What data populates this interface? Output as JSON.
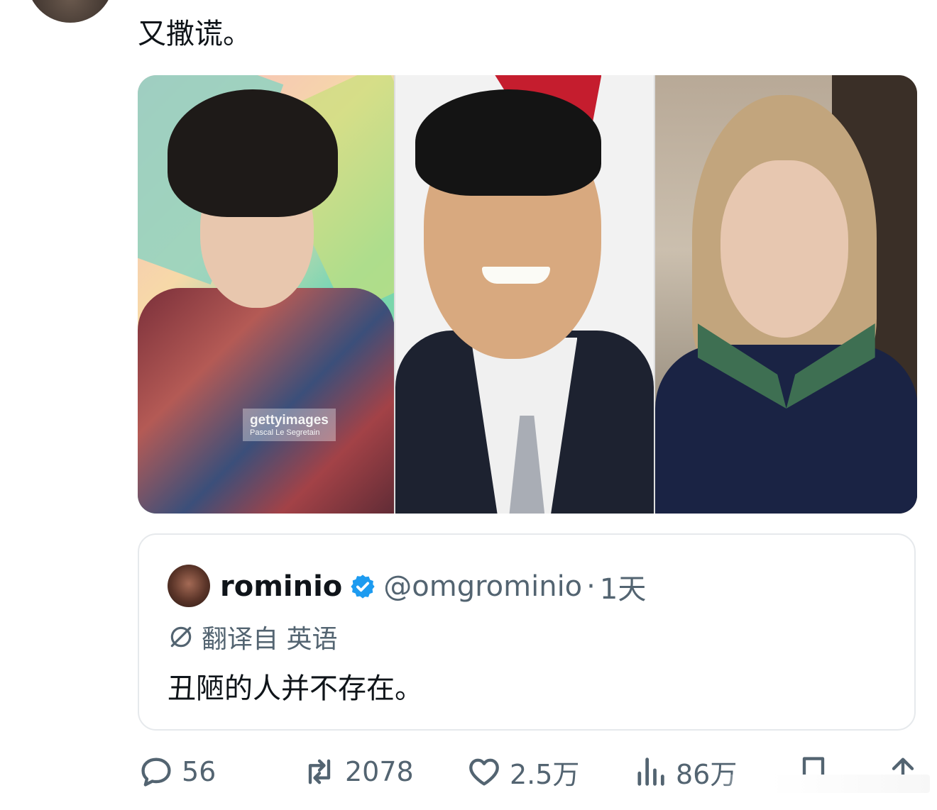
{
  "tweet": {
    "text": "又撒谎。"
  },
  "media": {
    "watermark_brand": "gettyimages",
    "watermark_credit": "Pascal Le Segretain"
  },
  "quote": {
    "display_name": "rominio",
    "handle": "@omgrominio",
    "separator": "·",
    "time": "1天",
    "translate_label": "翻译自 英语",
    "body": "丑陋的人并不存在。",
    "verified_icon": "verified-badge-icon",
    "verified_color": "#1d9bf0"
  },
  "actions": {
    "reply_count": "56",
    "retweet_count": "2078",
    "like_count": "2.5万",
    "views_count": "86万",
    "reply_icon": "reply-icon",
    "retweet_icon": "retweet-icon",
    "like_icon": "heart-icon",
    "views_icon": "views-icon",
    "bookmark_icon": "bookmark-icon",
    "share_icon": "share-icon",
    "icon_color": "#536471"
  }
}
